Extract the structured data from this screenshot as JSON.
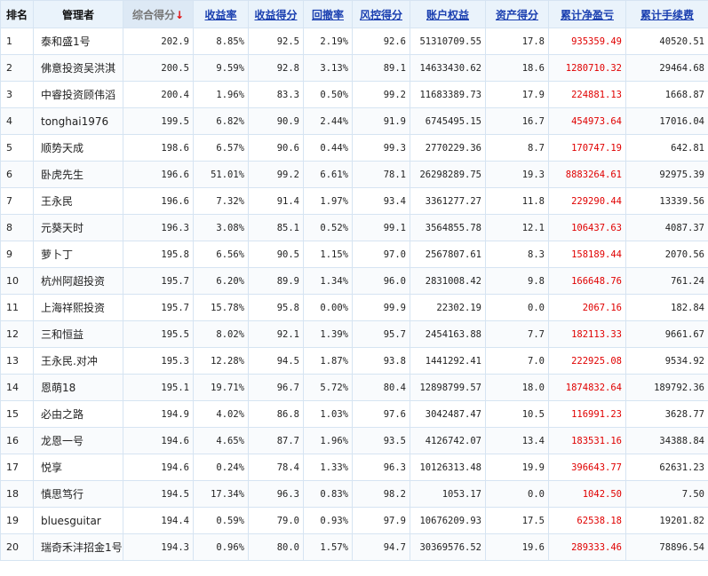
{
  "columns": [
    {
      "key": "rank",
      "label": "排名",
      "style": "plain"
    },
    {
      "key": "manager",
      "label": "管理者",
      "style": "plain"
    },
    {
      "key": "total_score",
      "label": "综合得分",
      "style": "sorted",
      "sort_icon": "down-arrow-icon",
      "sort_glyph": "↓"
    },
    {
      "key": "return_rate",
      "label": "收益率",
      "style": "link"
    },
    {
      "key": "return_score",
      "label": "收益得分",
      "style": "link"
    },
    {
      "key": "drawdown",
      "label": "回撤率",
      "style": "link"
    },
    {
      "key": "risk_score",
      "label": "风控得分",
      "style": "link"
    },
    {
      "key": "equity",
      "label": "账户权益",
      "style": "link"
    },
    {
      "key": "asset_score",
      "label": "资产得分",
      "style": "link"
    },
    {
      "key": "net_pnl",
      "label": "累计净盈亏",
      "style": "link"
    },
    {
      "key": "fees",
      "label": "累计手续费",
      "style": "link"
    }
  ],
  "colors": {
    "profit": "#e00000",
    "link": "#1a3fb0",
    "header_bg": "#eaf3fb",
    "grid": "#d6e4f2"
  },
  "rows": [
    [
      "1",
      "泰和盛1号",
      "202.9",
      "8.85%",
      "92.5",
      "2.19%",
      "92.6",
      "51310709.55",
      "17.8",
      "935359.49",
      "40520.51"
    ],
    [
      "2",
      "佛意投资吴洪淇",
      "200.5",
      "9.59%",
      "92.8",
      "3.13%",
      "89.1",
      "14633430.62",
      "18.6",
      "1280710.32",
      "29464.68"
    ],
    [
      "3",
      "中睿投资顾伟滔",
      "200.4",
      "1.96%",
      "83.3",
      "0.50%",
      "99.2",
      "11683389.73",
      "17.9",
      "224881.13",
      "1668.87"
    ],
    [
      "4",
      "tonghai1976",
      "199.5",
      "6.82%",
      "90.9",
      "2.44%",
      "91.9",
      "6745495.15",
      "16.7",
      "454973.64",
      "17016.04"
    ],
    [
      "5",
      "顺势天成",
      "198.6",
      "6.57%",
      "90.6",
      "0.44%",
      "99.3",
      "2770229.36",
      "8.7",
      "170747.19",
      "642.81"
    ],
    [
      "6",
      "卧虎先生",
      "196.6",
      "51.01%",
      "99.2",
      "6.61%",
      "78.1",
      "26298289.75",
      "19.3",
      "8883264.61",
      "92975.39"
    ],
    [
      "7",
      "王永民",
      "196.6",
      "7.32%",
      "91.4",
      "1.97%",
      "93.4",
      "3361277.27",
      "11.8",
      "229290.44",
      "13339.56"
    ],
    [
      "8",
      "元葵天时",
      "196.3",
      "3.08%",
      "85.1",
      "0.52%",
      "99.1",
      "3564855.78",
      "12.1",
      "106437.63",
      "4087.37"
    ],
    [
      "9",
      "萝卜丁",
      "195.8",
      "6.56%",
      "90.5",
      "1.15%",
      "97.0",
      "2567807.61",
      "8.3",
      "158189.44",
      "2070.56"
    ],
    [
      "10",
      "杭州阿超投资",
      "195.7",
      "6.20%",
      "89.9",
      "1.34%",
      "96.0",
      "2831008.42",
      "9.8",
      "166648.76",
      "761.24"
    ],
    [
      "11",
      "上海祥熙投资",
      "195.7",
      "15.78%",
      "95.8",
      "0.00%",
      "99.9",
      "22302.19",
      "0.0",
      "2067.16",
      "182.84"
    ],
    [
      "12",
      "三和恒益",
      "195.5",
      "8.02%",
      "92.1",
      "1.39%",
      "95.7",
      "2454163.88",
      "7.7",
      "182113.33",
      "9661.67"
    ],
    [
      "13",
      "王永民.对冲",
      "195.3",
      "12.28%",
      "94.5",
      "1.87%",
      "93.8",
      "1441292.41",
      "7.0",
      "222925.08",
      "9534.92"
    ],
    [
      "14",
      "恩萌18",
      "195.1",
      "19.71%",
      "96.7",
      "5.72%",
      "80.4",
      "12898799.57",
      "18.0",
      "1874832.64",
      "189792.36"
    ],
    [
      "15",
      "必由之路",
      "194.9",
      "4.02%",
      "86.8",
      "1.03%",
      "97.6",
      "3042487.47",
      "10.5",
      "116991.23",
      "3628.77"
    ],
    [
      "16",
      "龙恩一号",
      "194.6",
      "4.65%",
      "87.7",
      "1.96%",
      "93.5",
      "4126742.07",
      "13.4",
      "183531.16",
      "34388.84"
    ],
    [
      "17",
      "悦享",
      "194.6",
      "0.24%",
      "78.4",
      "1.33%",
      "96.3",
      "10126313.48",
      "19.9",
      "396643.77",
      "62631.23"
    ],
    [
      "18",
      "慎思笃行",
      "194.5",
      "17.34%",
      "96.3",
      "0.83%",
      "98.2",
      "1053.17",
      "0.0",
      "1042.50",
      "7.50"
    ],
    [
      "19",
      "bluesguitar",
      "194.4",
      "0.59%",
      "79.0",
      "0.93%",
      "97.9",
      "10676209.93",
      "17.5",
      "62538.18",
      "19201.82"
    ],
    [
      "20",
      "瑞奇禾沣招金1号",
      "194.3",
      "0.96%",
      "80.0",
      "1.57%",
      "94.7",
      "30369576.52",
      "19.6",
      "289333.46",
      "78896.54"
    ]
  ]
}
